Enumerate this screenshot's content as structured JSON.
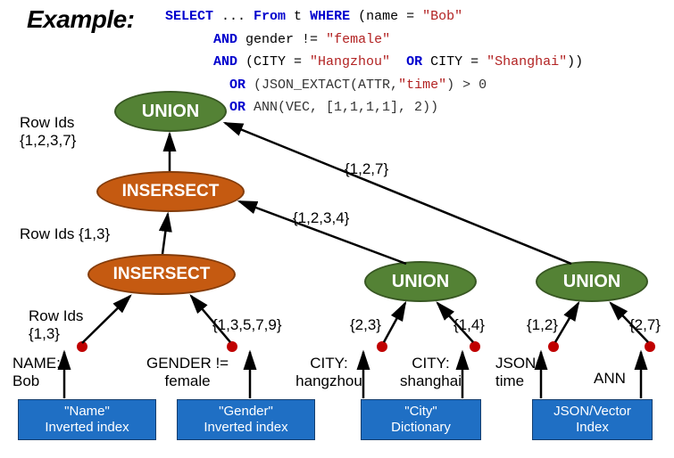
{
  "title": "Example:",
  "sql": {
    "l1a": "SELECT",
    "l1b": " ... ",
    "l1c": "From",
    "l1d": " t ",
    "l1e": "WHERE",
    "l1f": " (name = ",
    "l1g": "\"Bob\"",
    "l2a": "AND",
    "l2b": " gender != ",
    "l2c": "\"female\"",
    "l3a": "AND",
    "l3b": " (CITY = ",
    "l3c": "\"Hangzhou\"",
    "l3d": "  ",
    "l3e": "OR",
    "l3f": " CITY = ",
    "l3g": "\"Shanghai\"",
    "l3h": "))",
    "l4a": "OR",
    "l4b": " (JSON_EXTACT(ATTR,",
    "l4c": "\"time\"",
    "l4d": ") > 0",
    "l5a": "OR",
    "l5b": " ANN(VEC, [1,1,1,1], 2))"
  },
  "nodes": {
    "union_top": "UNION",
    "intersect_mid": "INSERSECT",
    "intersect_bot": "INSERSECT",
    "union_city": "UNION",
    "union_json": "UNION"
  },
  "annotations": {
    "rowids_top_a": "Row Ids",
    "rowids_top_b": "{1,2,3,7}",
    "rowids_mid": "Row Ids {1,3}",
    "rowids_bot_a": "Row Ids",
    "rowids_bot_b": "{1,3}",
    "set_13579": "{1,3,5,7,9}",
    "set_1234": "{1,2,3,4}",
    "set_127": "{1,2,7}",
    "set_23": "{2,3}",
    "set_14": "{1,4}",
    "set_12": "{1,2}",
    "set_27": "{2,7}",
    "name_a": "NAME:",
    "name_b": "Bob",
    "gender_a": "GENDER !=",
    "gender_b": "female",
    "city_h_a": "CITY:",
    "city_h_b": "hangzhou",
    "city_s_a": "CITY:",
    "city_s_b": "shanghai",
    "json_a": "JSON:",
    "json_b": "time",
    "ann": "ANN"
  },
  "leaves": {
    "name_a": "\"Name\"",
    "name_b": "Inverted index",
    "gender_a": "\"Gender\"",
    "gender_b": "Inverted index",
    "city_a": "\"City\"",
    "city_b": "Dictionary",
    "json_a": "JSON/Vector",
    "json_b": "Index"
  }
}
